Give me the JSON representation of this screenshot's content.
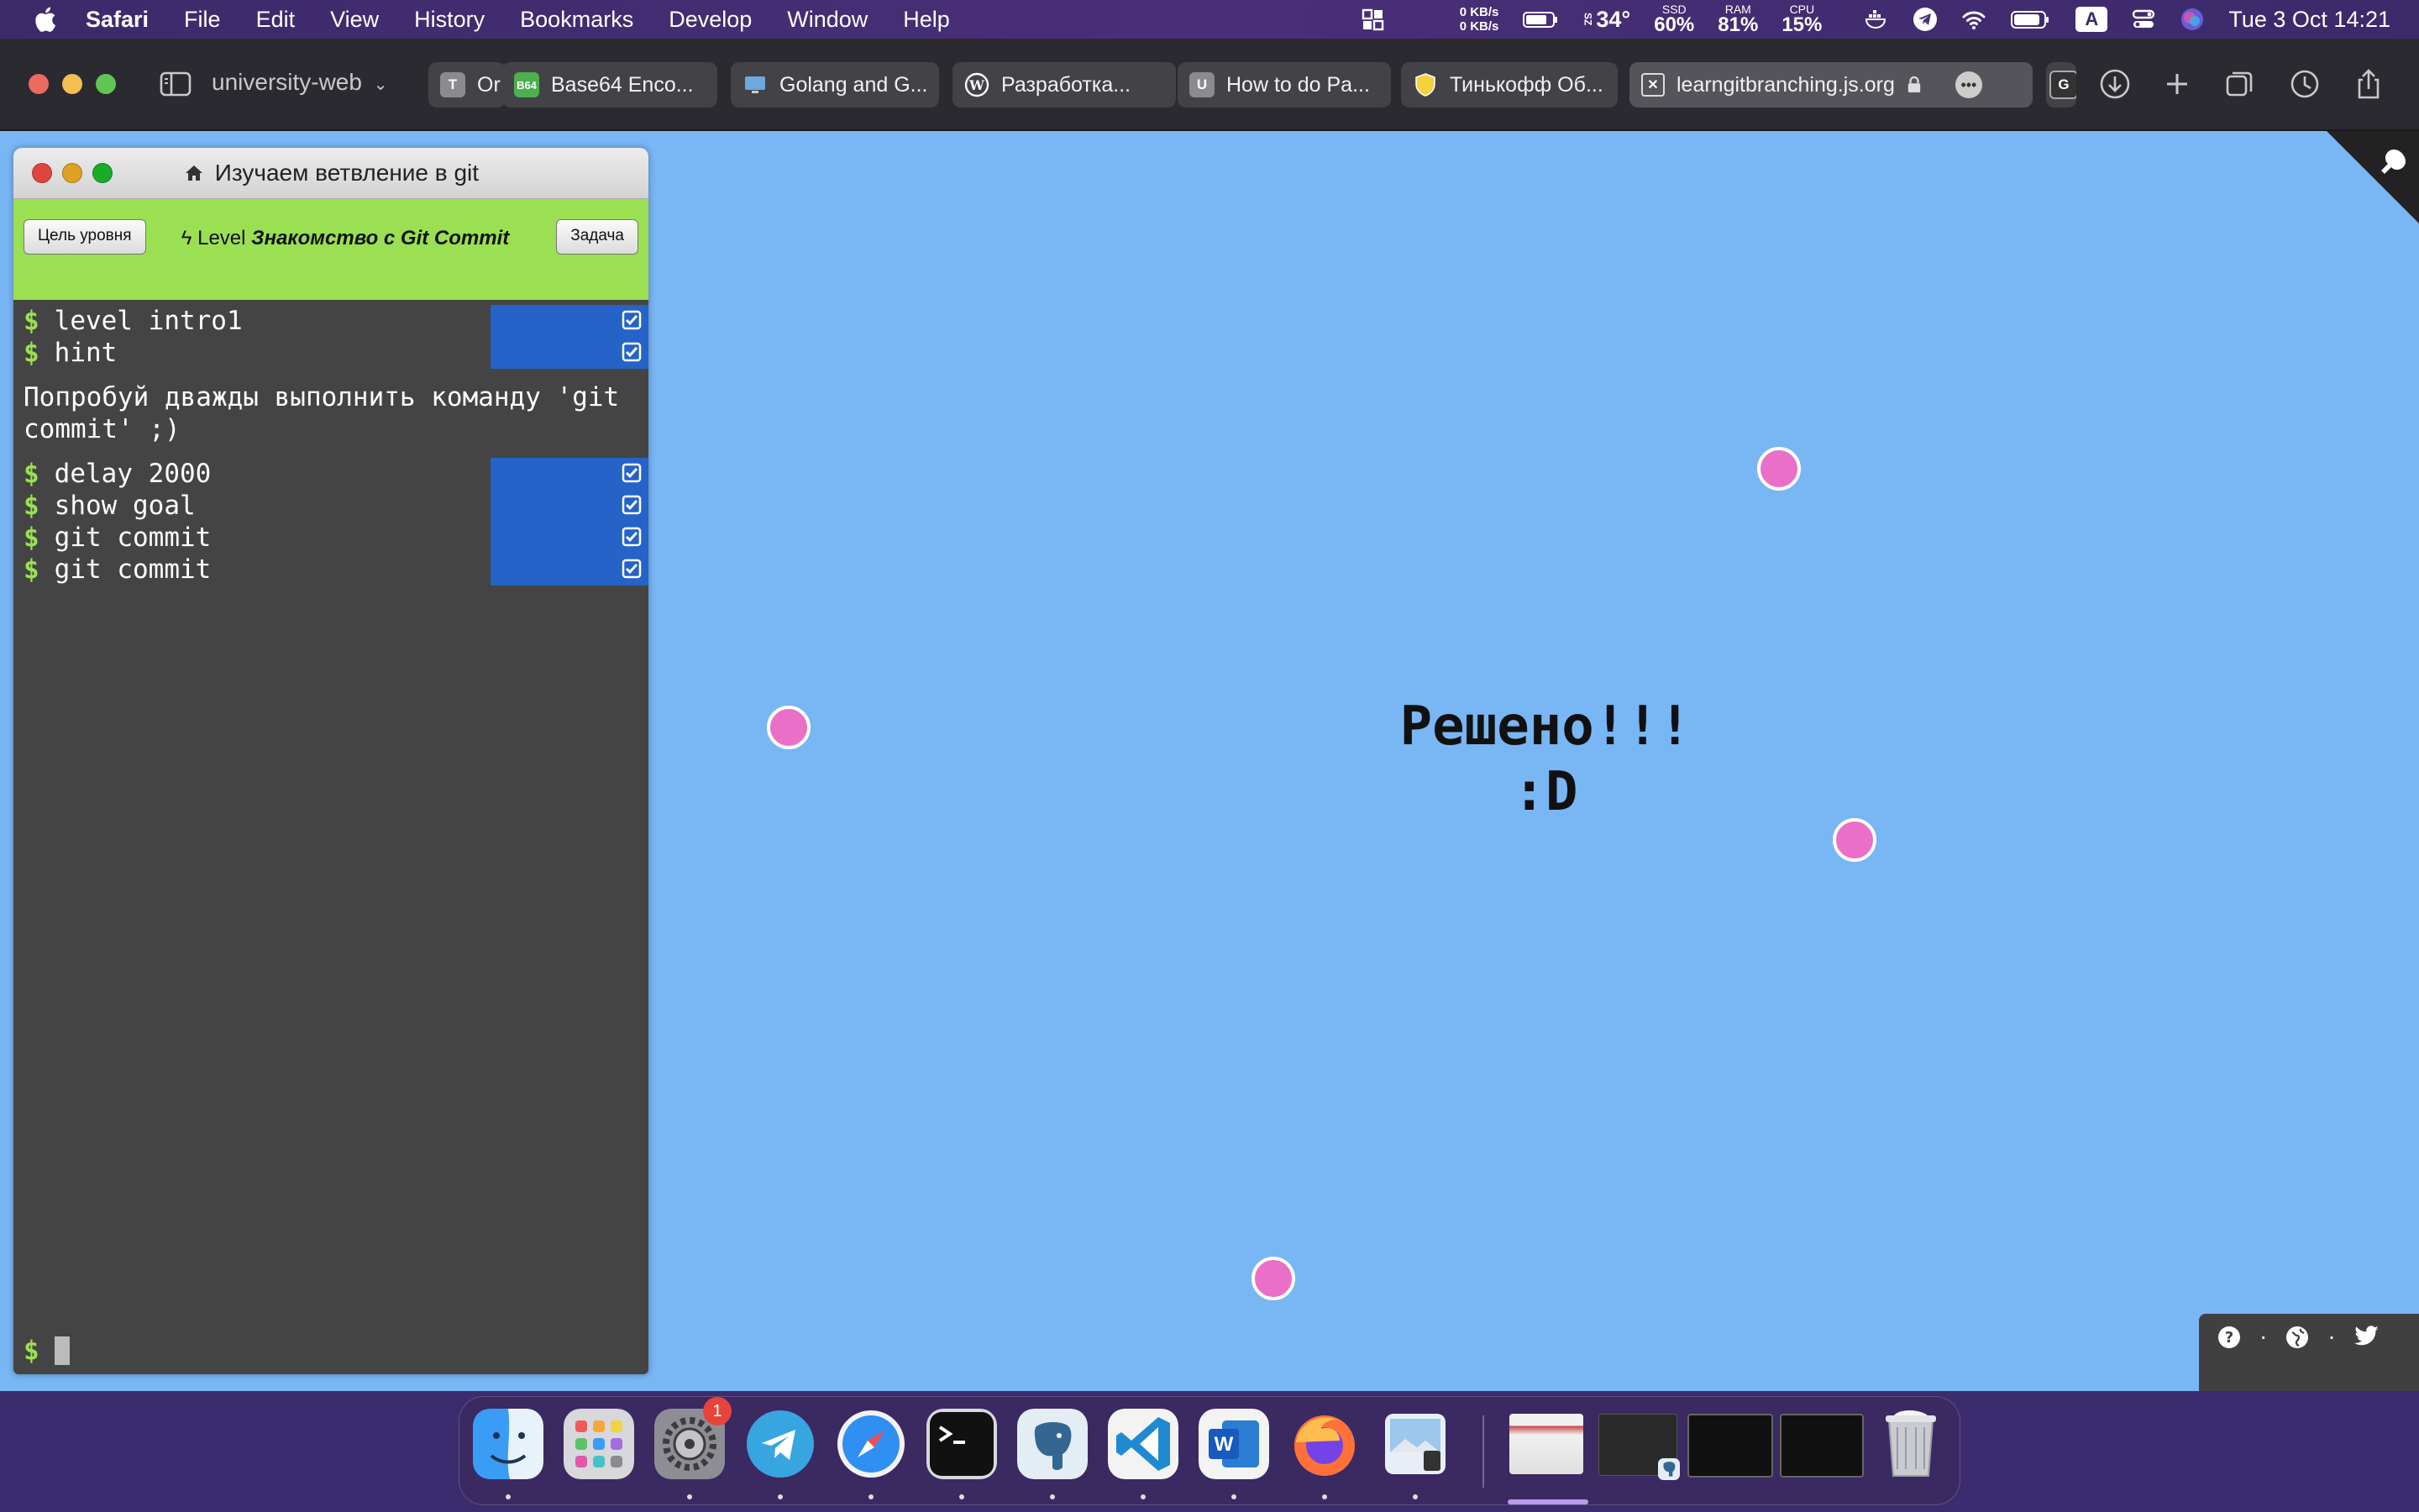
{
  "menubar": {
    "app_name": "Safari",
    "menus": [
      "File",
      "Edit",
      "View",
      "History",
      "Bookmarks",
      "Develop",
      "Window",
      "Help"
    ],
    "net_up": "0 KB/s",
    "net_down": "0 KB/s",
    "temp": "34°",
    "ssd_label": "SSD",
    "ssd_value": "60%",
    "ram_label": "RAM",
    "ram_value": "81%",
    "cpu_label": "CPU",
    "cpu_value": "15%",
    "input_source": "A",
    "datetime": "Tue 3 Oct  14:21"
  },
  "toolbar": {
    "profile": "university-web",
    "tabs": [
      {
        "title": "Or",
        "favicon": "T"
      },
      {
        "title": "Base64 Enco...",
        "favicon": "B64"
      },
      {
        "title": "Golang and G...",
        "favicon": "monitor"
      },
      {
        "title": "Разработка...",
        "favicon": "W"
      },
      {
        "title": "How to do Pa...",
        "favicon": "U"
      },
      {
        "title": "Тинькофф Об...",
        "favicon": "shield"
      },
      {
        "title": "learngitbranching.js.org",
        "favicon": "x"
      }
    ]
  },
  "command_window": {
    "title": "Изучаем ветвление в git",
    "goal_button": "Цель уровня",
    "level_prefix": "Level",
    "level_name": "Знакомство с Git Commit",
    "task_button": "Задача",
    "commands_top": [
      {
        "text": "level intro1"
      },
      {
        "text": "hint"
      }
    ],
    "hint_text": "Попробуй дважды выполнить команду 'git commit' ;)",
    "commands_bottom": [
      {
        "text": "delay 2000"
      },
      {
        "text": "show goal"
      },
      {
        "text": "git commit"
      },
      {
        "text": "git commit"
      }
    ],
    "prompt": "$"
  },
  "visualization": {
    "solved_line1": "Решено!!!",
    "solved_line2": ":D"
  },
  "helpbar": {
    "icons": [
      "help-icon",
      "globe-icon",
      "twitter-icon"
    ]
  },
  "dock": {
    "apps": [
      "Finder",
      "Launchpad",
      "System Settings",
      "Telegram",
      "Safari",
      "Terminal",
      "PostgreSQL",
      "Visual Studio Code",
      "Microsoft Word",
      "Firefox",
      "Preview"
    ],
    "settings_badge": "1"
  },
  "colors": {
    "page_bg": "#79b6f4",
    "level_bar": "#9be052",
    "command_check_bg": "#2563c8",
    "commit_node": "#e96fc8",
    "terminal_bg": "#444444"
  }
}
